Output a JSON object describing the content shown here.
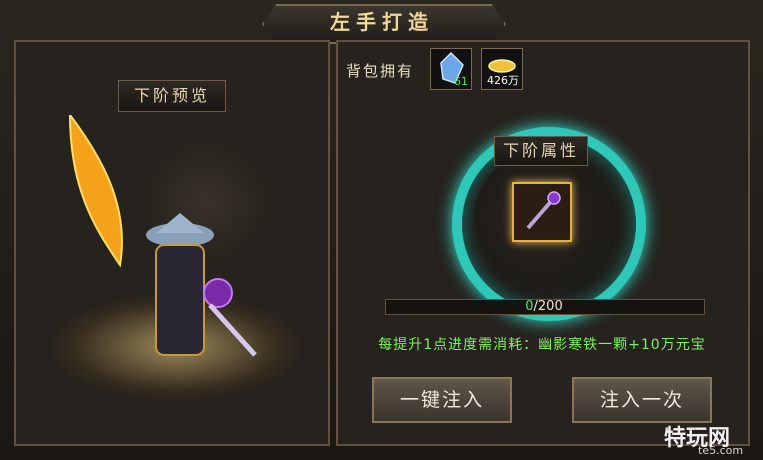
{
  "title": "左手打造",
  "preview_label": "下阶预览",
  "bag": {
    "label": "背包拥有",
    "items": [
      {
        "icon": "crystal-icon",
        "count": "61",
        "count_color": "#57e85a"
      },
      {
        "icon": "gold-ingot-icon",
        "count": "426万",
        "count_color": "#ffffff"
      }
    ]
  },
  "attr_label": "下阶属性",
  "progress": {
    "current": 0,
    "max": 200,
    "current_text": "0",
    "max_text": "/200"
  },
  "cost_text": "每提升1点进度需消耗：幽影寒铁一颗+10万元宝",
  "buttons": {
    "inject_all": "一键注入",
    "inject_once": "注入一次"
  },
  "watermark": {
    "brand": "特玩网",
    "url": "te5.com"
  }
}
